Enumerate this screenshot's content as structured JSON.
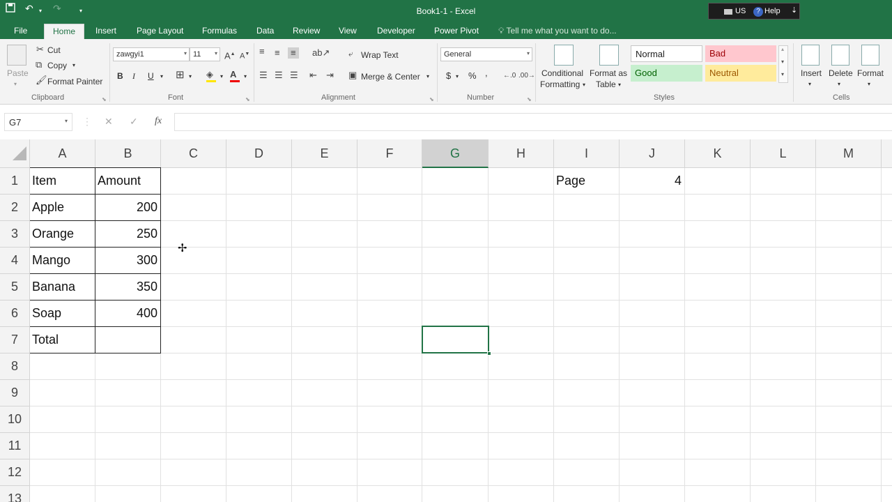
{
  "titlebar": {
    "title": "Book1-1 - Excel",
    "help_locale": "US",
    "help_label": "Help",
    "icons": [
      "save-icon",
      "undo-icon",
      "redo-icon",
      "customize-quick-access-icon"
    ]
  },
  "tabs": [
    "File",
    "Home",
    "Insert",
    "Page Layout",
    "Formulas",
    "Data",
    "Review",
    "View",
    "Developer",
    "Power Pivot"
  ],
  "active_tab": "Home",
  "tell_me": "Tell me what you want to do...",
  "ribbon": {
    "clipboard": {
      "paste": "Paste",
      "cut": "Cut",
      "copy": "Copy",
      "format_painter": "Format Painter",
      "label": "Clipboard"
    },
    "font": {
      "name": "zawgyi1",
      "size": "11",
      "bold": "B",
      "italic": "I",
      "underline": "U",
      "label": "Font"
    },
    "alignment": {
      "wrap": "Wrap Text",
      "merge": "Merge & Center",
      "label": "Alignment"
    },
    "number": {
      "format": "General",
      "currency": "$",
      "percent": "%",
      "comma": ",",
      "label": "Number"
    },
    "styles": {
      "conditional": "Conditional",
      "formatting": "Formatting",
      "format_as": "Format as",
      "table": "Table",
      "normal": "Normal",
      "bad": "Bad",
      "good": "Good",
      "neutral": "Neutral",
      "label": "Styles"
    },
    "cells": {
      "insert": "Insert",
      "delete": "Delete",
      "format": "Format",
      "label": "Cells"
    }
  },
  "formula_bar": {
    "name_box": "G7",
    "cancel": "✕",
    "enter": "✓",
    "fx": "fx",
    "value": ""
  },
  "columns": [
    "A",
    "B",
    "C",
    "D",
    "E",
    "F",
    "G",
    "H",
    "I",
    "J",
    "K",
    "L",
    "M"
  ],
  "selected_column": "G",
  "rows": [
    "1",
    "2",
    "3",
    "4",
    "5",
    "6",
    "7",
    "8",
    "9",
    "10",
    "11",
    "12",
    "13"
  ],
  "cells": {
    "A1": "Item",
    "B1": "Amount",
    "A2": "Apple",
    "B2": "200",
    "A3": "Orange",
    "B3": "250",
    "A4": "Mango",
    "B4": "300",
    "A5": "Banana",
    "B5": "350",
    "A6": "Soap",
    "B6": "400",
    "A7": "Total",
    "B7": "",
    "I1": "Page",
    "J1": "4"
  },
  "selected_cell": "G7",
  "colors": {
    "accent": "#217346",
    "bad_fill": "#ffc7ce",
    "bad_text": "#9c0006",
    "good_fill": "#c6efce",
    "good_text": "#006100",
    "neutral_fill": "#ffeb9c",
    "neutral_text": "#9c5700"
  }
}
